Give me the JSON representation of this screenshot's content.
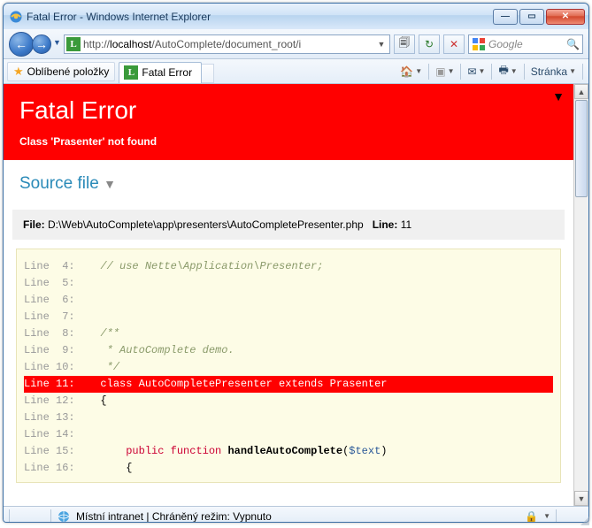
{
  "window": {
    "title": "Fatal Error - Windows Internet Explorer"
  },
  "nav": {
    "url_prefix": "http://",
    "url_host": "localhost",
    "url_path": "/AutoComplete/document_root/i",
    "search_placeholder": "Google"
  },
  "favorites": {
    "label": "Oblíbené položky"
  },
  "tab": {
    "title": "Fatal Error"
  },
  "toolbar": {
    "page_label": "Stránka"
  },
  "error": {
    "heading": "Fatal Error",
    "message": "Class 'Prasenter' not found"
  },
  "source": {
    "section_title": "Source file",
    "file_label": "File:",
    "file_path": "D:\\Web\\AutoComplete\\app\\presenters\\AutoCompletePresenter.php",
    "line_label": "Line:",
    "line_no": "11"
  },
  "code": {
    "l4_no": "Line  4:",
    "l4_c": "// use Nette\\Application\\Presenter;",
    "l5_no": "Line  5:",
    "l6_no": "Line  6:",
    "l7_no": "Line  7:",
    "l8_no": "Line  8:",
    "l8_c": "/**",
    "l9_no": "Line  9:",
    "l9_c": " * AutoComplete demo.",
    "l10_no": "Line 10:",
    "l10_c": " */",
    "l11_no": "Line 11:",
    "l11_t": "class AutoCompletePresenter extends Prasenter",
    "l12_no": "Line 12:",
    "l12_t": "{",
    "l13_no": "Line 13:",
    "l14_no": "Line 14:",
    "l15_no": "Line 15:",
    "l15_k1": "public",
    "l15_k2": "function",
    "l15_fn": "handleAutoComplete",
    "l15_p1": "(",
    "l15_v": "$text",
    "l15_p2": ")",
    "l16_no": "Line 16:",
    "l16_t": "{"
  },
  "status": {
    "zone_text": "Místní intranet | Chráněný režim: Vypnuto"
  }
}
